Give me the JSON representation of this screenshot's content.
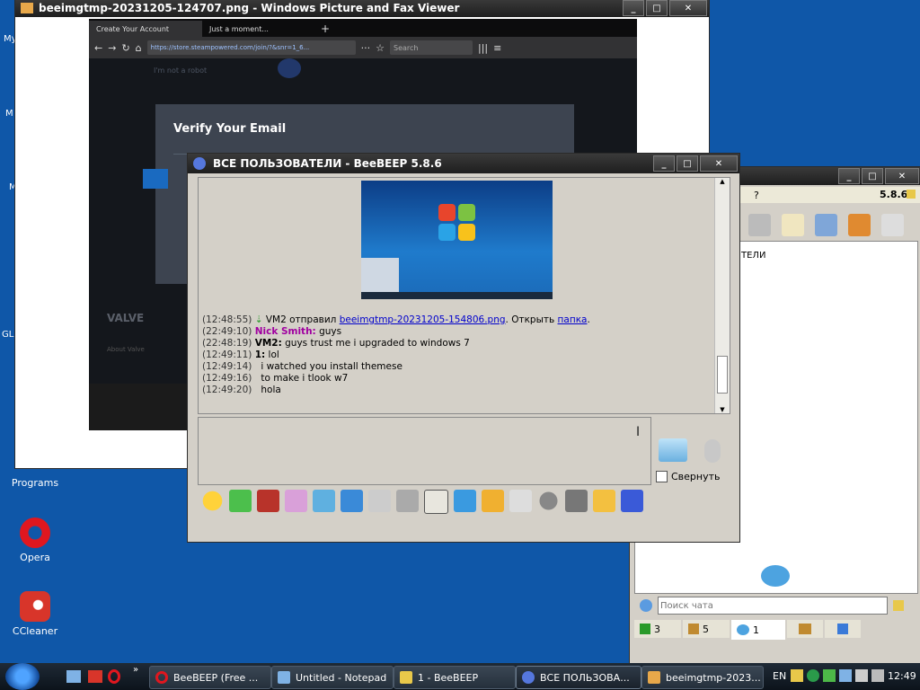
{
  "desktop": {
    "cut_labels": [
      "My",
      "M",
      "M",
      "GL"
    ],
    "programs_label": "Programs",
    "icons": [
      {
        "label": "Opera",
        "icon": "opera-icon",
        "color": "#e0171f"
      },
      {
        "label": "CCleaner",
        "icon": "ccleaner-icon",
        "color": "#d8352a"
      }
    ]
  },
  "picture_viewer": {
    "title": "beeimgtmp-20231205-124707.png - Windows Picture and Fax Viewer",
    "firefox": {
      "tabs": [
        "Create Your Account",
        "Just a moment..."
      ],
      "url": "https://store.steampowered.com/join/?&snr=1_6...",
      "search_placeholder": "Search",
      "modal_title": "Verify Your Email",
      "bg_text_1": "I'm not a robot",
      "bg_text_2": "VALVE",
      "bg_text_3": "About Valve"
    }
  },
  "beebeep_main": {
    "title": "ВСЕ ПОЛЬЗОВАТЕЛИ - BeeBEEP 5.8.6",
    "messages": [
      {
        "time": "(12:48:55)",
        "sender": "",
        "text": "VM2 отправил ",
        "link": "beeimgtmp-20231205-154806.png",
        "after": ". Открыть ",
        "link2": "папка",
        "end": "."
      },
      {
        "time": "(22:49:10)",
        "sender": "Nick Smith:",
        "text": " guys"
      },
      {
        "time": "(22:48:19)",
        "sender": "VM2:",
        "text": " guys trust me i upgraded to windows 7"
      },
      {
        "time": "(12:49:11)",
        "sender": "1:",
        "text": " lol"
      },
      {
        "time": "(12:49:14)",
        "sender": "",
        "text": "i watched you install themese"
      },
      {
        "time": "(12:49:16)",
        "sender": "",
        "text": "to make i tlook w7"
      },
      {
        "time": "(12:49:20)",
        "sender": "",
        "text": "hola"
      }
    ],
    "collapse_label": "Свернуть"
  },
  "beebeep_side": {
    "menu_item": "?",
    "version": "5.8.6",
    "list_text": "ТЕЛИ",
    "search_placeholder": "Поиск чата",
    "tabs": [
      {
        "icon": "users-green-icon",
        "count": "3"
      },
      {
        "icon": "group-icon",
        "count": "5"
      },
      {
        "icon": "chat-bubbles-icon",
        "count": "1"
      },
      {
        "icon": "people-icon",
        "count": ""
      },
      {
        "icon": "flag-icon",
        "count": ""
      }
    ]
  },
  "taskbar": {
    "buttons": [
      {
        "label": "BeeBEEP (Free ...",
        "icon": "opera-icon",
        "color": "#e0171f"
      },
      {
        "label": "Untitled - Notepad",
        "icon": "notepad-icon",
        "color": "#7fb2e5"
      },
      {
        "label": "1 - BeeBEEP",
        "icon": "beebeep-icon",
        "color": "#e8c84a"
      },
      {
        "label": "ВСЕ ПОЛЬЗОВА...",
        "icon": "beebeep-icon",
        "color": "#5577dd"
      },
      {
        "label": "beeimgtmp-2023...",
        "icon": "picture-viewer-icon",
        "color": "#e8a84a"
      }
    ],
    "lang": "EN",
    "clock": "12:49"
  }
}
